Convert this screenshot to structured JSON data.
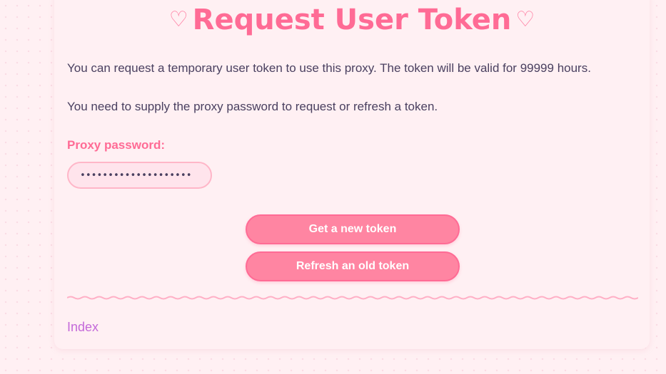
{
  "page": {
    "title": "Request User Token",
    "heart_glyph": "♡"
  },
  "intro": {
    "validity_text": "You can request a temporary user token to use this proxy. The token will be valid for 99999 hours.",
    "password_requirement_text": "You need to supply the proxy password to request or refresh a token."
  },
  "form": {
    "password_label": "Proxy password:",
    "password_value": "••••••••••••••••••••",
    "new_token_button": "Get a new token",
    "refresh_token_button": "Refresh an old token"
  },
  "footer": {
    "index_link": "Index"
  },
  "colors": {
    "accent": "#ff6b95",
    "button_fill": "#ff85a2",
    "link": "#c469d9",
    "background": "#fff0f3",
    "text": "#4a4060"
  },
  "icons": {
    "title_decoration": "heart-outline-icon"
  }
}
